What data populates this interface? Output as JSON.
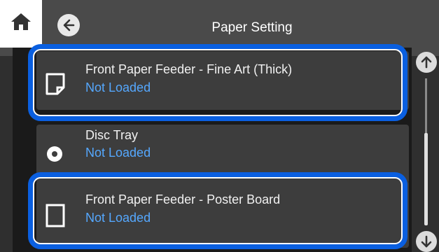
{
  "header": {
    "title": "Paper Setting",
    "home_icon": "home-icon",
    "back_icon": "back-arrow-icon"
  },
  "items": [
    {
      "label": "Front Paper Feeder - Fine Art (Thick)",
      "status": "Not Loaded",
      "icon": "paper-sheet-icon"
    },
    {
      "label": "Disc Tray",
      "status": "Not Loaded",
      "icon": "disc-icon"
    },
    {
      "label": "Front Paper Feeder - Poster Board",
      "status": "Not Loaded",
      "icon": "board-icon"
    }
  ],
  "scroll": {
    "up_icon": "scroll-up-icon",
    "down_icon": "scroll-down-icon"
  },
  "colors": {
    "status_text": "#55a8ff",
    "highlight": "#0a5fe0",
    "background": "#2f2f2f"
  }
}
